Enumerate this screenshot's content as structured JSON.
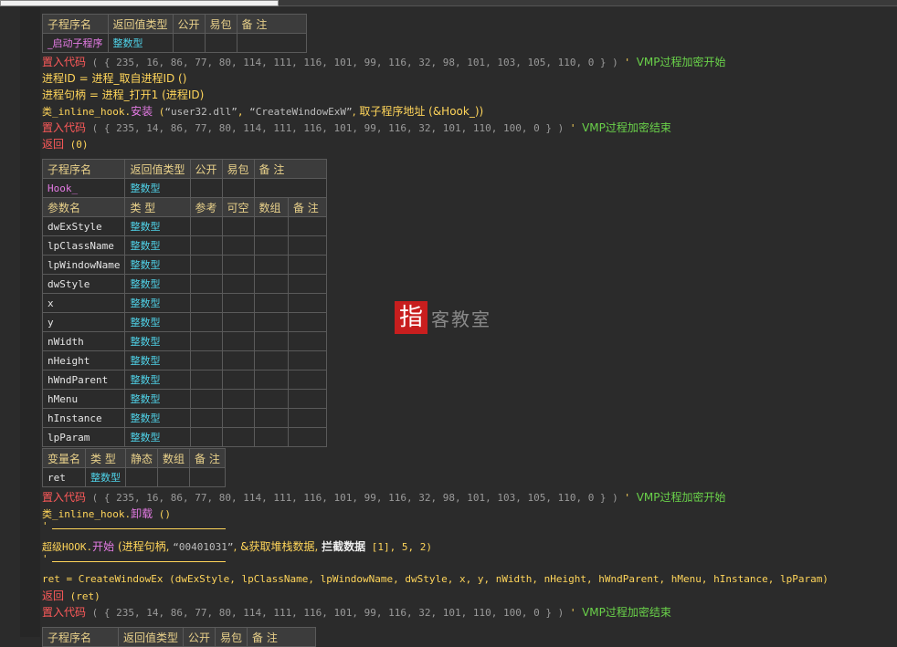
{
  "sub1": {
    "headers": [
      "子程序名",
      "返回值类型",
      "公开",
      "易包",
      "备 注"
    ],
    "name": "_启动子程序",
    "ret_type": "整数型"
  },
  "lines1": {
    "inject_start": {
      "kw": "置入代码",
      "nums": "( { 235, 16, 86, 77, 80, 114, 111, 116, 101, 99, 116, 32, 98, 101, 103, 105, 110, 0 } )",
      "sep": " ' ",
      "comment": "VMP过程加密开始"
    },
    "pid": "进程ID = 进程_取自进程ID ()",
    "handle": "进程句柄 = 进程_打开1 (进程ID)",
    "install_obj": "类_inline_hook.",
    "install_method": "安装",
    "install_open": " (",
    "install_arg1": "“user32.dll”",
    "install_comma": ", ",
    "install_arg2": "“CreateWindowExW”",
    "install_rest": ", 取子程序地址 (&Hook_))",
    "inject_end": {
      "kw": "置入代码",
      "nums": "( { 235, 14, 86, 77, 80, 114, 111, 116, 101, 99, 116, 32, 101, 110, 100, 0 } )",
      "sep": " ' ",
      "comment": "VMP过程加密结束"
    },
    "return_kw": "返回",
    "return_args": " (0)"
  },
  "sub2": {
    "headers": [
      "子程序名",
      "返回值类型",
      "公开",
      "易包",
      "备 注"
    ],
    "name": "Hook_",
    "ret_type": "整数型",
    "param_headers": [
      "参数名",
      "类 型",
      "参考",
      "可空",
      "数组",
      "备 注"
    ],
    "params": [
      {
        "name": "dwExStyle",
        "type": "整数型"
      },
      {
        "name": "lpClassName",
        "type": "整数型"
      },
      {
        "name": "lpWindowName",
        "type": "整数型"
      },
      {
        "name": "dwStyle",
        "type": "整数型"
      },
      {
        "name": "x",
        "type": "整数型"
      },
      {
        "name": "y",
        "type": "整数型"
      },
      {
        "name": "nWidth",
        "type": "整数型"
      },
      {
        "name": "nHeight",
        "type": "整数型"
      },
      {
        "name": "hWndParent",
        "type": "整数型"
      },
      {
        "name": "hMenu",
        "type": "整数型"
      },
      {
        "name": "hInstance",
        "type": "整数型"
      },
      {
        "name": "lpParam",
        "type": "整数型"
      }
    ]
  },
  "vars": {
    "headers": [
      "变量名",
      "类 型",
      "静态",
      "数组",
      "备 注"
    ],
    "name": "ret",
    "type": "整数型"
  },
  "lines2": {
    "inject_start": {
      "kw": "置入代码",
      "nums": "( { 235, 16, 86, 77, 80, 114, 111, 116, 101, 99, 116, 32, 98, 101, 103, 105, 110, 0 } )",
      "sep": " ' ",
      "comment": "VMP过程加密开始"
    },
    "uninstall_obj": "类_inline_hook.",
    "uninstall_method": "卸载",
    "uninstall_rest": " ()",
    "div_mark": "'",
    "superhook_obj": "超级HOOK.",
    "superhook_method": "开始",
    "superhook_open": " (进程句柄, ",
    "superhook_str": "“00401031”",
    "superhook_mid": ", &获取堆栈数据, ",
    "superhook_bold": "拦截数据",
    "superhook_rest": " [1], 5, 2)",
    "div_mark2": "'",
    "call": "ret = CreateWindowEx (dwExStyle, lpClassName, lpWindowName, dwStyle, x, y, nWidth, nHeight, hWndParent, hMenu, hInstance, lpParam)",
    "return_kw": "返回",
    "return_args": " (ret)",
    "inject_end": {
      "kw": "置入代码",
      "nums": "( { 235, 14, 86, 77, 80, 114, 111, 116, 101, 99, 116, 32, 101, 110, 100, 0 } )",
      "sep": " ' ",
      "comment": "VMP过程加密结束"
    }
  },
  "sub3": {
    "headers": [
      "子程序名",
      "返回值类型",
      "公开",
      "易包",
      "备 注"
    ]
  },
  "watermark": {
    "badge": "指",
    "text": "客教室"
  }
}
